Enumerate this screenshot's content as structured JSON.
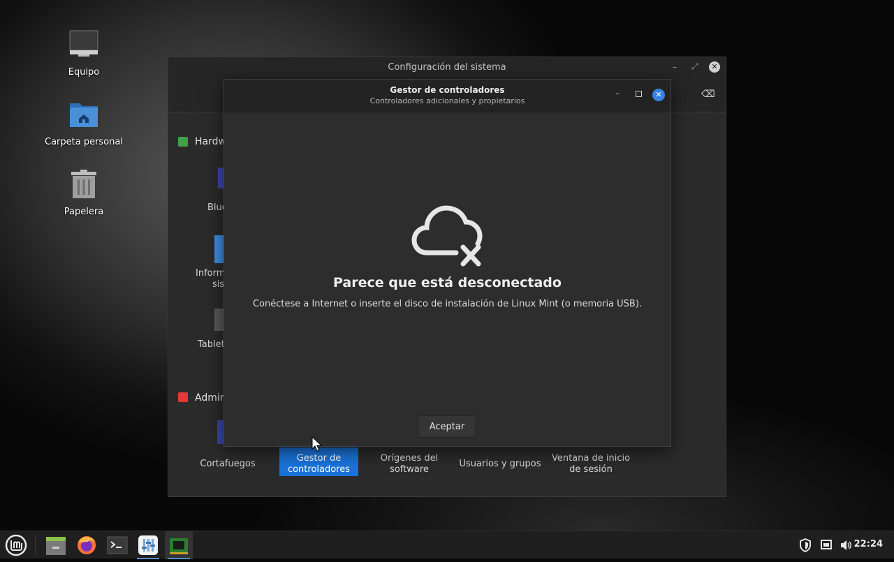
{
  "desktop": {
    "icons": [
      {
        "label": "Equipo",
        "icon": "computer-icon"
      },
      {
        "label": "Carpeta personal",
        "icon": "home-folder-icon"
      },
      {
        "label": "Papelera",
        "icon": "trash-icon"
      }
    ]
  },
  "settings_window": {
    "title": "Configuración del sistema",
    "sections": [
      {
        "label_partial": "Hardw",
        "icon": "hardware-icon",
        "color": "#4caf50"
      },
      {
        "label_partial": "Admin",
        "icon": "admin-icon",
        "color": "#e53935"
      }
    ],
    "hardware_items_partial": [
      "Blue",
      "Inform",
      "sis",
      "Tablet"
    ],
    "admin_items": [
      {
        "label_line1": "Cortafuegos",
        "label_line2": ""
      },
      {
        "label_line1": "Gestor de",
        "label_line2": "controladores",
        "selected": true
      },
      {
        "label_line1": "Orígenes del",
        "label_line2": "software"
      },
      {
        "label_line1": "Usuarios y grupos",
        "label_line2": ""
      },
      {
        "label_line1": "Ventana de inicio",
        "label_line2": "de sesión"
      }
    ]
  },
  "dialog": {
    "title": "Gestor de controladores",
    "subtitle": "Controladores adicionales y propietarios",
    "icon": "cloud-offline-icon",
    "heading": "Parece que está desconectado",
    "message": "Conéctese a Internet o inserte el disco de instalación de Linux Mint (o memoria USB).",
    "ok_label": "Aceptar"
  },
  "taskbar": {
    "items": [
      "mint-menu-icon",
      "files-icon",
      "firefox-icon",
      "terminal-icon",
      "settings-app-icon",
      "driver-manager-icon"
    ],
    "tray": [
      "shield-icon",
      "network-icon",
      "volume-icon"
    ],
    "clock": "22:24"
  },
  "colors": {
    "accent": "#1f7fe0",
    "close_button": "#3584e4",
    "selected_item": "#1a73d9"
  }
}
